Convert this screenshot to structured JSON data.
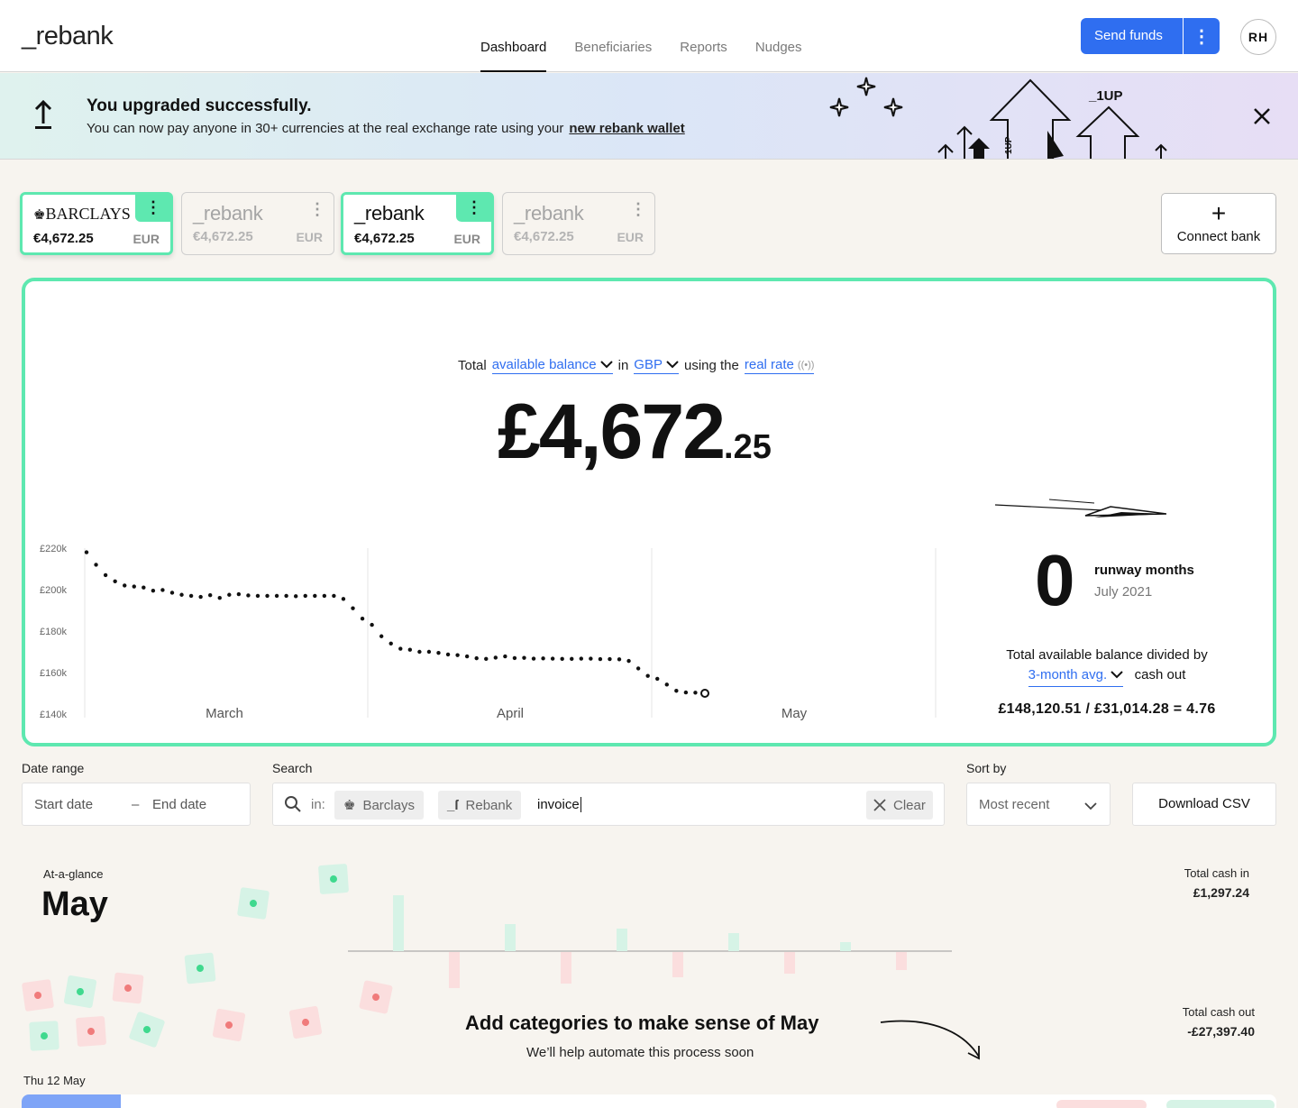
{
  "header": {
    "logo": "_rebank",
    "tabs": [
      {
        "label": "Dashboard",
        "active": true
      },
      {
        "label": "Beneficiaries",
        "active": false
      },
      {
        "label": "Reports",
        "active": false
      },
      {
        "label": "Nudges",
        "active": false
      }
    ],
    "send_label": "Send funds",
    "avatar_initials": "RH"
  },
  "banner": {
    "title": "You upgraded successfully.",
    "text": "You can now pay anyone in 30+ currencies at the real exchange rate using your",
    "link": "new rebank wallet",
    "art_label": "_1UP",
    "art_label_small": "1UP"
  },
  "accounts": [
    {
      "name": "BARCLAYS",
      "amount": "€4,672.25",
      "currency": "EUR",
      "selected": true
    },
    {
      "name": "_rebank",
      "amount": "€4,672.25",
      "currency": "EUR",
      "selected": false
    },
    {
      "name": "_rebank",
      "amount": "€4,672.25",
      "currency": "EUR",
      "selected": true
    },
    {
      "name": "_rebank",
      "amount": "€4,672.25",
      "currency": "EUR",
      "selected": false
    }
  ],
  "connect_bank": {
    "label": "Connect bank"
  },
  "balance": {
    "prefix": "Total",
    "metric": "available balance",
    "in": "in",
    "currency": "GBP",
    "using": "using the",
    "rate": "real rate",
    "amount_main": "£4,672",
    "amount_cents": ".25"
  },
  "chart_data": {
    "type": "line",
    "ylabels": [
      "£220k",
      "£200k",
      "£180k",
      "£160k",
      "£140k"
    ],
    "ylim": [
      140000,
      220000
    ],
    "xlabels": [
      "March",
      "April",
      "May"
    ],
    "series": [
      {
        "values": [
          218000,
          212000,
          207000,
          204000,
          202000,
          201500,
          201000,
          199500,
          199800,
          198500,
          197500,
          197000,
          196500,
          197300,
          196000,
          197500,
          197800,
          197200,
          197000,
          197000,
          197000,
          197000,
          196800,
          197000,
          197000,
          197000,
          197000,
          195500,
          191000,
          186000,
          183000,
          177500,
          174000,
          171500,
          171000,
          170000,
          170000,
          169500,
          168700,
          168400,
          167800,
          166900,
          166600,
          167200,
          167800,
          167000,
          167100,
          166700,
          166800,
          166700,
          166600,
          166600,
          166700,
          166700,
          166500,
          166500,
          166400,
          165600,
          162000,
          158400,
          157000,
          154200,
          151200,
          150400,
          150300
        ]
      }
    ],
    "last_point": 150000
  },
  "runway": {
    "months": "0",
    "label": "runway months",
    "date": "July 2021",
    "desc": "Total available balance divided by",
    "avg": "3-month avg.",
    "cash_out": "cash out",
    "equation": "£148,120.51 / £31,014.28 = 4.76"
  },
  "filters": {
    "date_range_label": "Date range",
    "start_placeholder": "Start date",
    "dash": "–",
    "end_placeholder": "End date",
    "search_label": "Search",
    "in_label": "in:",
    "chip_barclays": "Barclays",
    "chip_rebank": "Rebank",
    "search_value": "invoice",
    "clear_label": "Clear",
    "sort_label": "Sort by",
    "sort_value": "Most recent",
    "csv_label": "Download CSV"
  },
  "glance": {
    "label": "At-a-glance",
    "month": "May",
    "cash_in_label": "Total cash in",
    "cash_in": "£1,297.24",
    "cash_out_label": "Total cash out",
    "cash_out": "-£27,397.40",
    "cat_title": "Add categories to make sense of May",
    "cat_sub": "We’ll help automate this process soon",
    "day_label": "Thu 12 May",
    "bars_in": [
      62,
      30,
      25,
      20,
      10
    ],
    "bars_out": [
      40,
      35,
      28,
      24,
      20
    ],
    "colors": {
      "green": "#d6f3e6",
      "red": "#fbdede",
      "accent": "#5ee8b0",
      "blue": "#2f6ef0"
    }
  }
}
